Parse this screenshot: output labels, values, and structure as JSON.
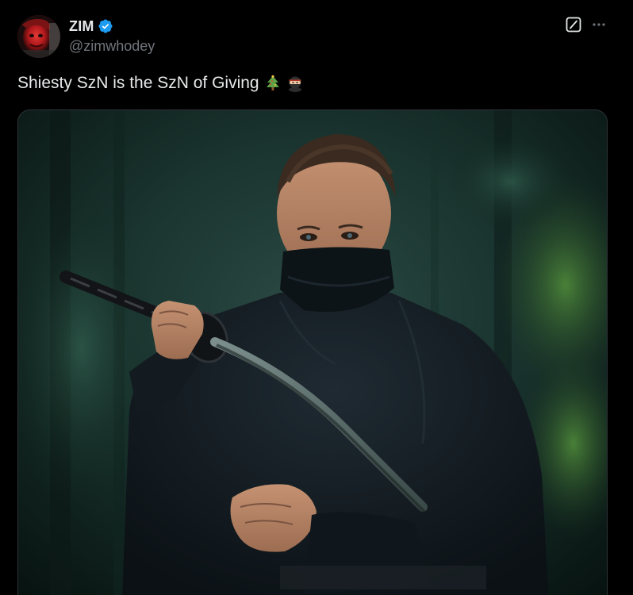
{
  "tweet": {
    "author": {
      "display_name": "ZIM",
      "handle": "@zimwhodey",
      "verified": true
    },
    "text": "Shiesty SzN is the SzN of Giving",
    "emojis": [
      "christmas-tree",
      "ninja"
    ],
    "media": {
      "type": "photo",
      "subject": "masked ninja with katana in forest"
    }
  },
  "colors": {
    "background": "#000000",
    "text_primary": "#e7e9ea",
    "text_secondary": "#71767b",
    "verified_blue": "#1d9bf0",
    "border": "#2f3336"
  },
  "icons": {
    "verified": "verified-badge-icon",
    "grok": "grok-icon",
    "more": "more-options-icon"
  }
}
